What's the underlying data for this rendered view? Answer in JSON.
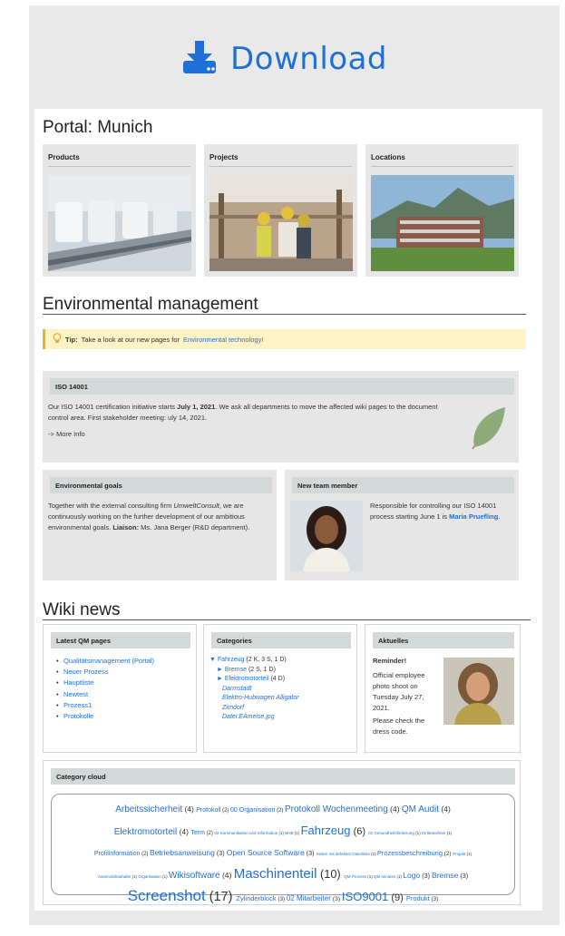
{
  "download": {
    "label": "Download",
    "icon": "download-icon",
    "color": "#1f6fd8"
  },
  "portal": {
    "title": "Portal: Munich",
    "tiles": [
      {
        "title": "Products",
        "image": "factory-bottles-photo"
      },
      {
        "title": "Projects",
        "image": "construction-workers-photo"
      },
      {
        "title": "Locations",
        "image": "office-building-mountains-photo"
      }
    ]
  },
  "env": {
    "title": "Environmental management",
    "tip": {
      "label": "Tip:",
      "text": "Take a look at our new pages for",
      "link": "Environmental technology!"
    },
    "iso": {
      "title": "ISO 14001",
      "p1": "Our ISO 14001 certification initiative starts",
      "p1_bold": "July 1, 2021",
      "p1_rest": ". We ask all departments to move the affected wiki pages to the document control area. First stakeholder meeting: uly 14, 2021.",
      "more": "-> More Info"
    },
    "goals": {
      "title": "Environmental goals",
      "t1": "Together with the external consulting firm",
      "t1_em": "UmweltConsult",
      "t2": ", we are continuously working on the further development of our ambitious environmental goals.",
      "liaison_label": "Liaison:",
      "liaison": "Ms. Jana Berger (R&D department)."
    },
    "member": {
      "title": "New team member",
      "text": "Responsible for controlling our ISO 14001 process starting June 1 is",
      "name": "Maria Pruefling",
      "end": "."
    }
  },
  "wiki": {
    "title": "Wiki news",
    "latest": {
      "title": "Latest QM pages",
      "items": [
        "Qualitätsmanagement (Portal)",
        "Neuer Prozess",
        "Hauptliste",
        "Newtest",
        "Prozess1",
        "Protokolle"
      ]
    },
    "categories": {
      "title": "Categories",
      "root": "Fahrzeug",
      "root_count": "(2 K, 3 S, 1 D)",
      "sub1": "Bremse",
      "sub1_count": "(2 S, 1 D)",
      "sub2": "Elektromotorteil",
      "sub2_count": "(4 D)",
      "pages": [
        "Darmstadt",
        "Elektro-Hubwagen Alligator",
        "Zirndorf",
        "Datei:EAmeise.jpg"
      ]
    },
    "news": {
      "title": "Aktuelles",
      "reminder": "Reminder!",
      "text": "Official employee photo shoot on Tuesday July 27, 2021.",
      "link": "Please check the dress code."
    },
    "cloud": {
      "title": "Category cloud",
      "rows": [
        [
          [
            "Arbeitssicherheit",
            "(4)",
            10
          ],
          [
            "Protokoll",
            "(2)",
            7
          ],
          [
            "00 Organisation",
            "(2)",
            7
          ],
          [
            "Protokoll Wochenmeeting",
            "(4)",
            10
          ],
          [
            "QM Audit",
            "(4)",
            10
          ]
        ],
        [
          [
            "Elektromotorteil",
            "(4)",
            10
          ],
          [
            "Term",
            "(2)",
            7
          ],
          [
            "02 Kommunikation und Information",
            "(1)",
            4.5
          ],
          [
            "BHB",
            "(1)",
            4.5
          ],
          [
            "Fahrzeug",
            "(6)",
            13
          ],
          [
            "02 Gesundheitsförderung",
            "(1)",
            4.5
          ],
          [
            "01 Bewohner",
            "(1)",
            4.5
          ]
        ],
        [
          [
            "Profilinformation",
            "(2)",
            7
          ],
          [
            "Betriebsanweisung",
            "(3)",
            8.5
          ],
          [
            "Open Source Software",
            "(3)",
            8.5
          ],
          [
            "Seiten mit defekten Dateilinks",
            "(1)",
            4.5
          ],
          [
            "Prozessbeschreibung",
            "(2)",
            7.5
          ],
          [
            "Projekt",
            "(1)",
            4.5
          ]
        ],
        [
          [
            "Automobilradnabe",
            "(1)",
            4.5
          ],
          [
            "Organisation",
            "(1)",
            4.5
          ],
          [
            "Wikisoftware",
            "(4)",
            10
          ],
          [
            "Maschinenteil",
            "(10)",
            15
          ],
          [
            "QM Process",
            "(1)",
            4.5
          ],
          [
            "QM minutes",
            "(1)",
            4.5
          ],
          [
            "Logo",
            "(3)",
            8.5
          ],
          [
            "Bremse",
            "(3)",
            8.5
          ]
        ],
        [
          [
            "Screenshot",
            "(17)",
            17
          ],
          [
            "Zylinderblock",
            "(3)",
            7.5
          ],
          [
            "02 Mitarbeiter",
            "(3)",
            8
          ],
          [
            "ISO9001",
            "(9)",
            13
          ],
          [
            "Produkt",
            "(3)",
            7.5
          ]
        ]
      ]
    }
  }
}
